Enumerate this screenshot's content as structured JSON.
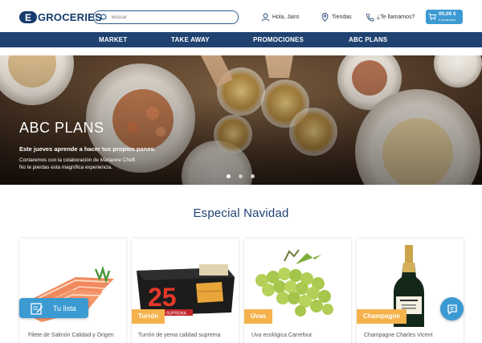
{
  "header": {
    "logo_letter": "E",
    "logo_text": "GROCERIES",
    "search_placeholder": "Buscar",
    "user_label": "Hola, Jairo",
    "stores_label": "Tiendas",
    "call_label": "¿Te llamamos?",
    "cart_price": "00,00 €",
    "cart_count": "0 productos"
  },
  "nav": {
    "items": [
      {
        "label": "MARKET"
      },
      {
        "label": "TAKE AWAY"
      },
      {
        "label": "PROMOCIONES"
      },
      {
        "label": "ABC PLANS"
      }
    ]
  },
  "hero": {
    "title": "ABC PLANS",
    "subtitle": "Este jueves aprende a hacer tus propios panes.",
    "desc_line1": "Contaremos con la colaboración de Marianne Cheff.",
    "desc_line2": "No te pierdas esta magnífica experiencia.",
    "active_slide": 1,
    "slides_total": 3
  },
  "section": {
    "title": "Especial Navidad"
  },
  "products": [
    {
      "tag": "",
      "name": "Filete de Salmón Calidad y Origen"
    },
    {
      "tag": "Turrón",
      "name": "Turrón de yema calidad suprema"
    },
    {
      "tag": "Uvas",
      "name": "Uva ecológica Carrefour"
    },
    {
      "tag": "Champagne",
      "name": "Champagne Charles Vicent"
    }
  ],
  "product_images": {
    "turron_box_number": "25",
    "turron_box_caption": "CALIDAD SUPREMA"
  },
  "widgets": {
    "tulista_label": "Tu lista"
  },
  "colors": {
    "brand_navy": "#1f4271",
    "accent_blue": "#3c9ad2",
    "tag_orange": "#f5b24c"
  }
}
